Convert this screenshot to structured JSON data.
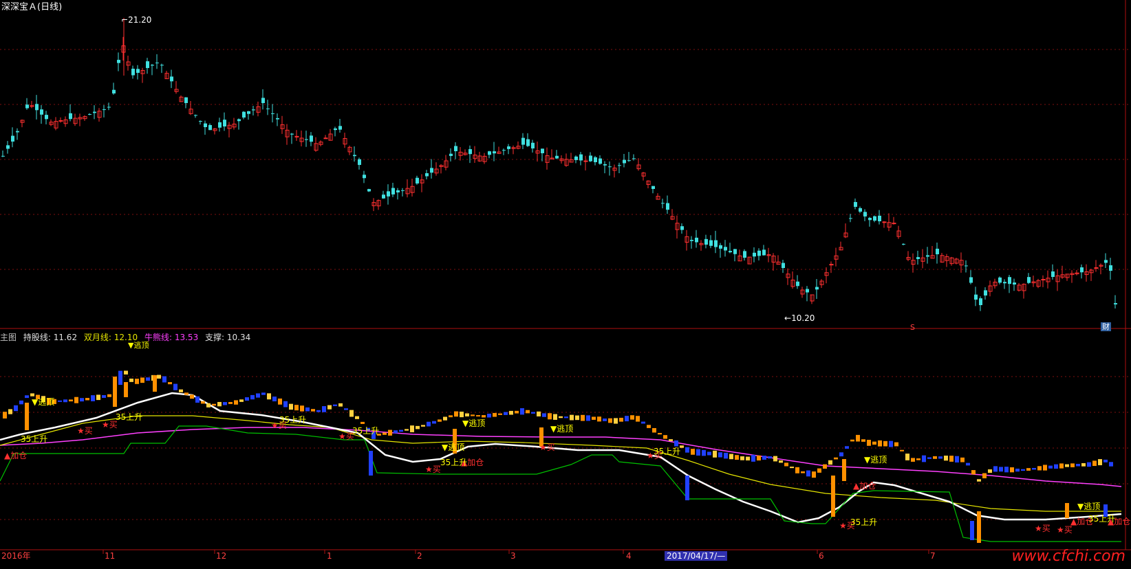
{
  "window": {
    "title": "深深宝Ａ(日线)"
  },
  "price_labels": {
    "high": "21.20",
    "low": "10.20"
  },
  "badges": {
    "finance": "财",
    "s_marker": "S"
  },
  "indicator": {
    "name": "主图",
    "items": [
      {
        "label": "持股线:",
        "value": "11.62",
        "color": "#e0e0e0"
      },
      {
        "label": "双月线:",
        "value": "12.10",
        "color": "#e6e600"
      },
      {
        "label": "牛熊线:",
        "value": "13.53",
        "color": "#ff40ff"
      },
      {
        "label": "支撑:",
        "value": "10.34",
        "color": "#e0e0e0"
      }
    ]
  },
  "signals": {
    "escape_top": "▼逃顶",
    "buy": "★买",
    "add_position": "▲加仓",
    "rise35": "35上升"
  },
  "x_axis": {
    "labels": [
      "2016年",
      "11",
      "12",
      "1",
      "2",
      "3",
      "4",
      "2017/04/17/—",
      "6",
      "7"
    ],
    "highlight_index": 7
  },
  "watermark": "www.cfchi.com",
  "colors": {
    "up": "#ff3030",
    "down": "#40e0e0",
    "grid": "#801010",
    "white_line": "#ffffff",
    "yellow_line": "#e6e600",
    "magenta_line": "#ff40ff",
    "green_line": "#00c000"
  },
  "chart_data": {
    "type": "candlestick",
    "title": "深深宝Ａ(日线)",
    "marked_high": 21.2,
    "marked_low": 10.2,
    "indicator_values": {
      "持股线": 11.62,
      "双月线": 12.1,
      "牛熊线": 13.53,
      "支撑": 10.34
    },
    "x_ticks": [
      "2016年",
      "11",
      "12",
      "1",
      "2",
      "3",
      "4",
      "2017/04/17/—",
      "6",
      "7"
    ]
  }
}
